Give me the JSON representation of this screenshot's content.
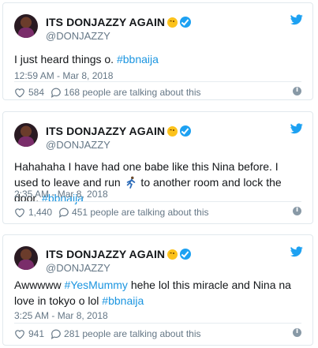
{
  "brand_color": "#1da1f2",
  "link_color": "#1b95e0",
  "icons": [
    "twitter-bird-icon",
    "verified-icon",
    "winking-emoji-icon",
    "heart-icon",
    "reply-bubble-icon",
    "info-icon",
    "runner-emoji-icon"
  ],
  "tweets": [
    {
      "display_name": "ITS DONJAZZY AGAIN",
      "handle": "@DONJAZZY",
      "text_parts": [
        "I just heard things o. ",
        "#bbnaija"
      ],
      "timestamp": "12:59 AM - Mar 8, 2018",
      "likes": "584",
      "talking": "168 people are talking about this"
    },
    {
      "display_name": "ITS DONJAZZY AGAIN",
      "handle": "@DONJAZZY",
      "text_parts": [
        "Hahahaha I have had one babe like this Nina before. I used to leave and run ",
        " to another room and lock the door. ",
        "#bbnaija"
      ],
      "timestamp": "2:35 AM - Mar 8, 2018",
      "likes": "1,440",
      "talking": "451 people are talking about this"
    },
    {
      "display_name": "ITS DONJAZZY AGAIN",
      "handle": "@DONJAZZY",
      "text_parts": [
        "Awwwww ",
        "#YesMummy",
        " hehe lol this miracle and Nina na love in tokyo o lol ",
        "#bbnaija"
      ],
      "timestamp": "3:25 AM - Mar 8, 2018",
      "likes": "941",
      "talking": "281 people are talking about this"
    }
  ]
}
